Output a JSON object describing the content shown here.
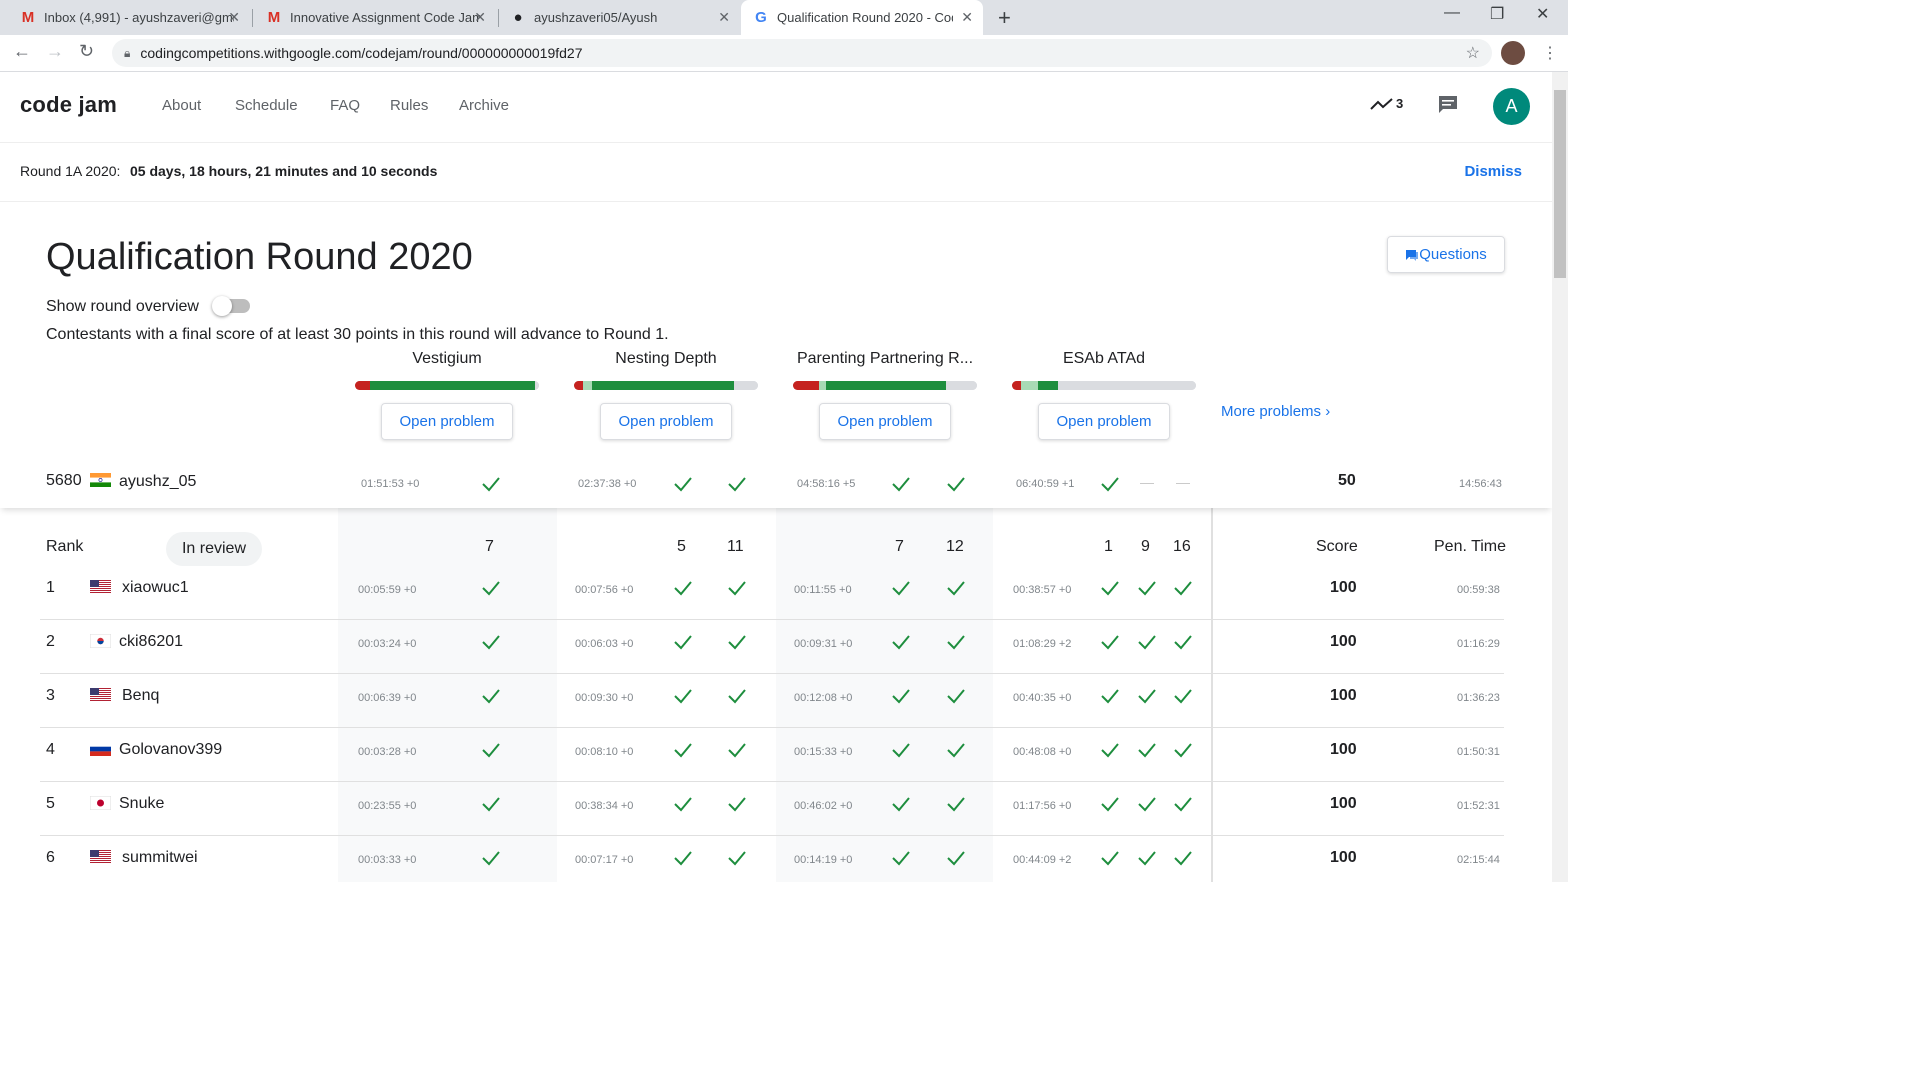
{
  "browser": {
    "tabs": [
      {
        "title": "Inbox (4,991) - ayushzaveri@gmail.com",
        "icon": "gmail-icon",
        "glyph": "M"
      },
      {
        "title": "Innovative Assignment Code Jam",
        "icon": "gmail-icon",
        "glyph": "M"
      },
      {
        "title": "ayushzaveri05/Ayush",
        "icon": "github-icon",
        "glyph": "●"
      },
      {
        "title": "Qualification Round 2020 - Code Jam",
        "icon": "google-icon",
        "glyph": "G"
      }
    ],
    "url": "codingcompetitions.withgoogle.com/codejam/round/000000000019fd27"
  },
  "header": {
    "logo": "code jam",
    "nav": [
      "About",
      "Schedule",
      "FAQ",
      "Rules",
      "Archive"
    ],
    "trend_count": "3",
    "avatar_letter": "A"
  },
  "banner": {
    "label": "Round 1A 2020:",
    "countdown": "05 days, 18 hours, 21 minutes and 10 seconds",
    "dismiss": "Dismiss"
  },
  "round": {
    "title": "Qualification Round 2020",
    "questions_btn": "Questions",
    "overview_label": "Show round overview",
    "advance_text": "Contestants with a final score of at least 30 points in this round will advance to Round 1.",
    "more_problems": "More problems"
  },
  "problems": [
    {
      "name": "Vestigium",
      "open": "Open problem",
      "bar": [
        {
          "c": "#c5221f",
          "w": 8
        },
        {
          "c": "#1e8e3e",
          "w": 90
        },
        {
          "c": "#dadce0",
          "w": 2
        }
      ]
    },
    {
      "name": "Nesting Depth",
      "open": "Open problem",
      "bar": [
        {
          "c": "#c5221f",
          "w": 5
        },
        {
          "c": "#a8dab5",
          "w": 5
        },
        {
          "c": "#1e8e3e",
          "w": 77
        },
        {
          "c": "#dadce0",
          "w": 13
        }
      ]
    },
    {
      "name": "Parenting Partnering R...",
      "open": "Open problem",
      "bar": [
        {
          "c": "#c5221f",
          "w": 14
        },
        {
          "c": "#a8dab5",
          "w": 4
        },
        {
          "c": "#1e8e3e",
          "w": 65
        },
        {
          "c": "#dadce0",
          "w": 17
        }
      ]
    },
    {
      "name": "ESAb ATAd",
      "open": "Open problem",
      "bar": [
        {
          "c": "#c5221f",
          "w": 5
        },
        {
          "c": "#a8dab5",
          "w": 9
        },
        {
          "c": "#1e8e3e",
          "w": 11
        },
        {
          "c": "#dadce0",
          "w": 75
        }
      ]
    }
  ],
  "my_row": {
    "rank": "5680",
    "flag": "in",
    "name": "ayushz_05",
    "times": [
      "01:51:53 +0",
      "02:37:38 +0",
      "04:58:16 +5",
      "06:40:59 +1"
    ],
    "score": "50",
    "pen": "14:56:43"
  },
  "leaderboard": {
    "headers": {
      "rank": "Rank",
      "in_review": "In review",
      "score": "Score",
      "pen_time": "Pen. Time"
    },
    "points": [
      [
        "7"
      ],
      [
        "5",
        "11"
      ],
      [
        "7",
        "12"
      ],
      [
        "1",
        "9",
        "16"
      ]
    ],
    "rows": [
      {
        "rank": "1",
        "flag": "us",
        "name": "xiaowuc1",
        "times": [
          "00:05:59 +0",
          "00:07:56 +0",
          "00:11:55 +0",
          "00:38:57 +0"
        ],
        "score": "100",
        "pen": "00:59:38"
      },
      {
        "rank": "2",
        "flag": "kr",
        "name": "cki86201",
        "times": [
          "00:03:24 +0",
          "00:06:03 +0",
          "00:09:31 +0",
          "01:08:29 +2"
        ],
        "score": "100",
        "pen": "01:16:29"
      },
      {
        "rank": "3",
        "flag": "us",
        "name": "Benq",
        "times": [
          "00:06:39 +0",
          "00:09:30 +0",
          "00:12:08 +0",
          "00:40:35 +0"
        ],
        "score": "100",
        "pen": "01:36:23"
      },
      {
        "rank": "4",
        "flag": "ru",
        "name": "Golovanov399",
        "times": [
          "00:03:28 +0",
          "00:08:10 +0",
          "00:15:33 +0",
          "00:48:08 +0"
        ],
        "score": "100",
        "pen": "01:50:31"
      },
      {
        "rank": "5",
        "flag": "jp",
        "name": "Snuke",
        "times": [
          "00:23:55 +0",
          "00:38:34 +0",
          "00:46:02 +0",
          "01:17:56 +0"
        ],
        "score": "100",
        "pen": "01:52:31"
      },
      {
        "rank": "6",
        "flag": "us",
        "name": "summitwei",
        "times": [
          "00:03:33 +0",
          "00:07:17 +0",
          "00:14:19 +0",
          "00:44:09 +2"
        ],
        "score": "100",
        "pen": "02:15:44"
      }
    ]
  }
}
